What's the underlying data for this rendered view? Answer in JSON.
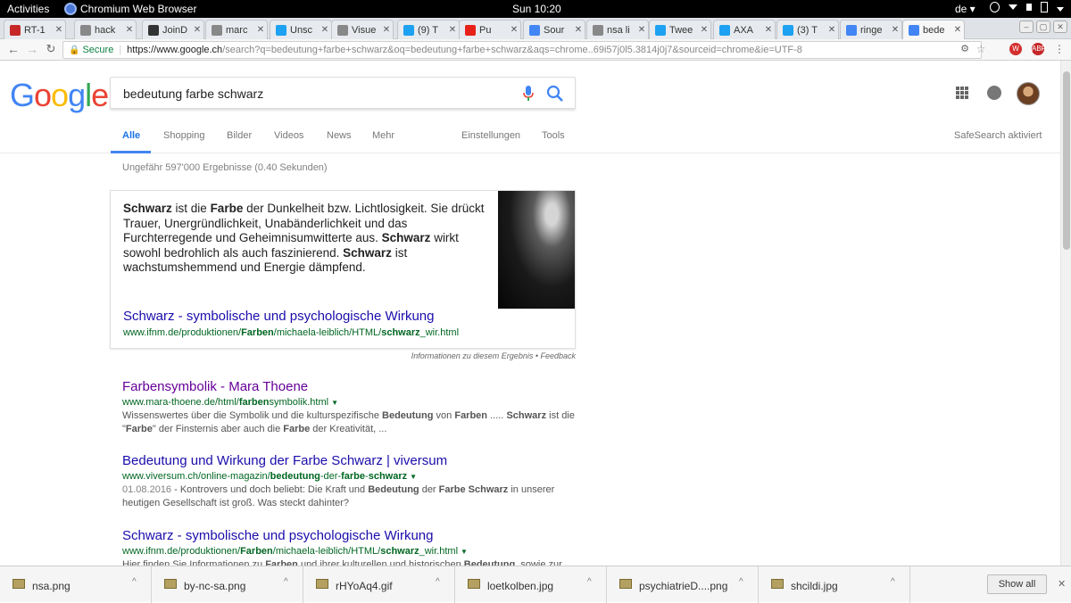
{
  "topbar": {
    "activities": "Activities",
    "app_name": "Chromium Web Browser",
    "clock": "Sun 10:20",
    "lang": "de ▾"
  },
  "tabs": [
    {
      "label": "RT-1",
      "favicon_color": "#c62828"
    },
    {
      "label": "hack",
      "favicon_color": "#888888"
    },
    {
      "label": "JoinD",
      "favicon_color": "#333333"
    },
    {
      "label": "marc",
      "favicon_color": "#888888"
    },
    {
      "label": "Unsc",
      "favicon_color": "#1da1f2"
    },
    {
      "label": "Visue",
      "favicon_color": "#888888"
    },
    {
      "label": "(9) T",
      "favicon_color": "#1da1f2"
    },
    {
      "label": "Pu",
      "favicon_color": "#e62117"
    },
    {
      "label": "Sour",
      "favicon_color": "#4285f4"
    },
    {
      "label": "nsa li",
      "favicon_color": "#888888"
    },
    {
      "label": "Twee",
      "favicon_color": "#1da1f2"
    },
    {
      "label": "AXA",
      "favicon_color": "#1da1f2"
    },
    {
      "label": "(3) T",
      "favicon_color": "#1da1f2"
    },
    {
      "label": "ringe",
      "favicon_color": "#4285f4"
    },
    {
      "label": "bede",
      "favicon_color": "#4285f4"
    }
  ],
  "toolbar": {
    "secure_label": "Secure",
    "url_host": "https://www.google.ch",
    "url_rest": "/search?q=bedeutung+farbe+schwarz&oq=bedeutung+farbe+schwarz&aqs=chrome..69i57j0l5.3814j0j7&sourceid=chrome&ie=UTF-8",
    "ext_badge": "ABP"
  },
  "google": {
    "logo": [
      "G",
      "o",
      "o",
      "g",
      "l",
      "e"
    ],
    "logo_colors": [
      "#4285f4",
      "#ea4335",
      "#fbbc05",
      "#4285f4",
      "#34a853",
      "#ea4335"
    ],
    "query": "bedeutung farbe schwarz",
    "nav": {
      "all": "Alle",
      "shopping": "Shopping",
      "images": "Bilder",
      "videos": "Videos",
      "news": "News",
      "more": "Mehr",
      "settings": "Einstellungen",
      "tools": "Tools",
      "safesearch": "SafeSearch aktiviert"
    },
    "result_stats": "Ungefähr 597'000 Ergebnisse (0.40 Sekunden)"
  },
  "snippet": {
    "text": [
      {
        "t": "Schwarz",
        "b": true
      },
      {
        "t": " ist die "
      },
      {
        "t": "Farbe",
        "b": true
      },
      {
        "t": " der Dunkelheit bzw. Lichtlosigkeit. Sie drückt Trauer, Unergründlichkeit, Unabänderlichkeit und das Furchterregende und Geheimnisumwitterte aus. "
      },
      {
        "t": "Schwarz",
        "b": true
      },
      {
        "t": " wirkt sowohl bedrohlich als auch faszinierend. "
      },
      {
        "t": "Schwarz",
        "b": true
      },
      {
        "t": " ist wachstumshemmend und Energie dämpfend."
      }
    ],
    "title": "Schwarz - symbolische und psychologische Wirkung",
    "url": [
      {
        "t": "www.ifnm.de/produktionen/"
      },
      {
        "t": "Farben",
        "b": true
      },
      {
        "t": "/michaela-leiblich/HTML/"
      },
      {
        "t": "schwarz",
        "b": true
      },
      {
        "t": "_wir.html"
      }
    ],
    "footer": "Informationen zu diesem Ergebnis • Feedback"
  },
  "results": [
    {
      "title": "Farbensymbolik - Mara Thoene",
      "visited": true,
      "url": [
        {
          "t": "www.mara-thoene.de/html/"
        },
        {
          "t": "farben",
          "b": true
        },
        {
          "t": "symbolik.html"
        }
      ],
      "date": "",
      "desc": [
        {
          "t": "Wissenswertes über die Symbolik und die kulturspezifische "
        },
        {
          "t": "Bedeutung",
          "b": true
        },
        {
          "t": " von "
        },
        {
          "t": "Farben",
          "b": true
        },
        {
          "t": " ..... "
        },
        {
          "t": "Schwarz",
          "b": true
        },
        {
          "t": " ist die \""
        },
        {
          "t": "Farbe",
          "b": true
        },
        {
          "t": "\" der Finsternis aber auch die "
        },
        {
          "t": "Farbe",
          "b": true
        },
        {
          "t": " der Kreativität, ..."
        }
      ]
    },
    {
      "title": "Bedeutung und Wirkung der Farbe Schwarz | viversum",
      "visited": false,
      "url": [
        {
          "t": "www.viversum.ch/online-magazin/"
        },
        {
          "t": "bedeutung",
          "b": true
        },
        {
          "t": "-der-"
        },
        {
          "t": "farbe",
          "b": true
        },
        {
          "t": "-"
        },
        {
          "t": "schwarz",
          "b": true
        }
      ],
      "date": "01.08.2016",
      "desc": [
        {
          "t": " - Kontrovers und doch beliebt: Die Kraft und "
        },
        {
          "t": "Bedeutung",
          "b": true
        },
        {
          "t": " der "
        },
        {
          "t": "Farbe Schwarz",
          "b": true
        },
        {
          "t": " in unserer heutigen Gesellschaft ist groß. Was steckt dahinter?"
        }
      ]
    },
    {
      "title": "Schwarz - symbolische und psychologische Wirkung",
      "visited": false,
      "url": [
        {
          "t": "www.ifnm.de/produktionen/"
        },
        {
          "t": "Farben",
          "b": true
        },
        {
          "t": "/michaela-leiblich/HTML/"
        },
        {
          "t": "schwarz",
          "b": true
        },
        {
          "t": "_wir.html"
        }
      ],
      "date": "",
      "desc": [
        {
          "t": "Hier finden Sie Informationen zu "
        },
        {
          "t": "Farben",
          "b": true
        },
        {
          "t": " und ihrer kulturellen und historischen "
        },
        {
          "t": "Bedeutung",
          "b": true
        },
        {
          "t": ", sowie zur"
        }
      ]
    }
  ],
  "downloads": {
    "items": [
      "nsa.png",
      "by-nc-sa.png",
      "rHYoAq4.gif",
      "loetkolben.jpg",
      "psychiatrieD....png",
      "shcildi.jpg"
    ],
    "show_all": "Show all"
  }
}
